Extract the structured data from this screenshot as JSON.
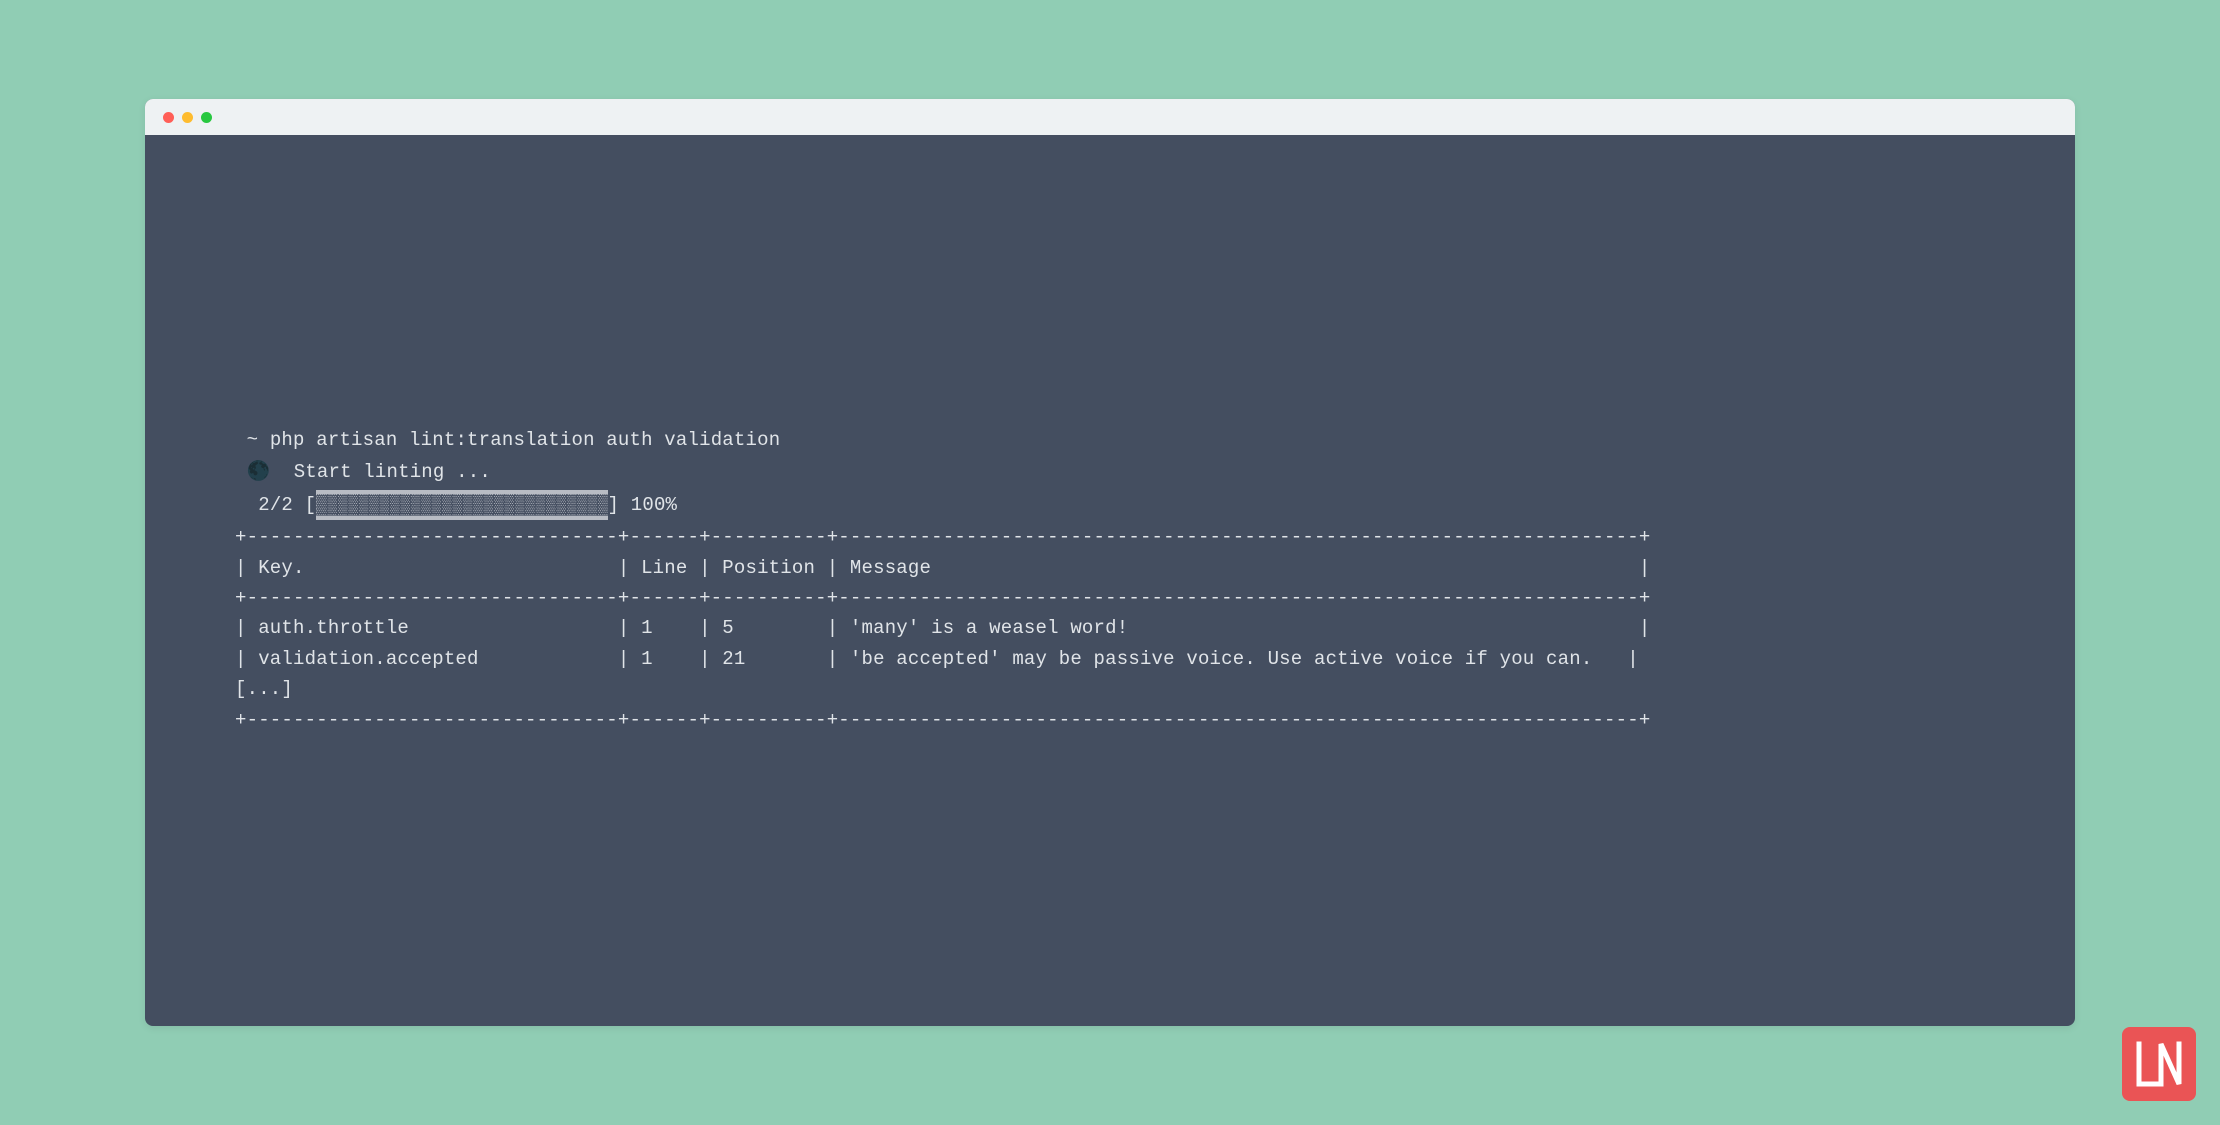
{
  "prompt": {
    "symbol": "~",
    "command": "php artisan lint:translation auth validation"
  },
  "status": {
    "icon": "🌑",
    "text": "Start linting ..."
  },
  "progress": {
    "counter": "2/2",
    "bar_open": "[",
    "bar_fill": "▓▓▓▓▓▓▓▓▓▓▓▓▓▓▓▓▓▓▓▓▓▓▓▓▓▓▓▓",
    "bar_close": "]",
    "percent": "100%"
  },
  "table": {
    "separator": "+--------------------------------+------+----------+---------------------------------------------------------------------+",
    "header": "| Key.                           | Line | Position | Message                                                             |",
    "rows": [
      "| auth.throttle                  | 1    | 5        | 'many' is a weasel word!                                            |",
      "| validation.accepted            | 1    | 21       | 'be accepted' may be passive voice. Use active voice if you can.   |"
    ],
    "truncate": "[...]"
  },
  "logo": {
    "label": "LN"
  }
}
